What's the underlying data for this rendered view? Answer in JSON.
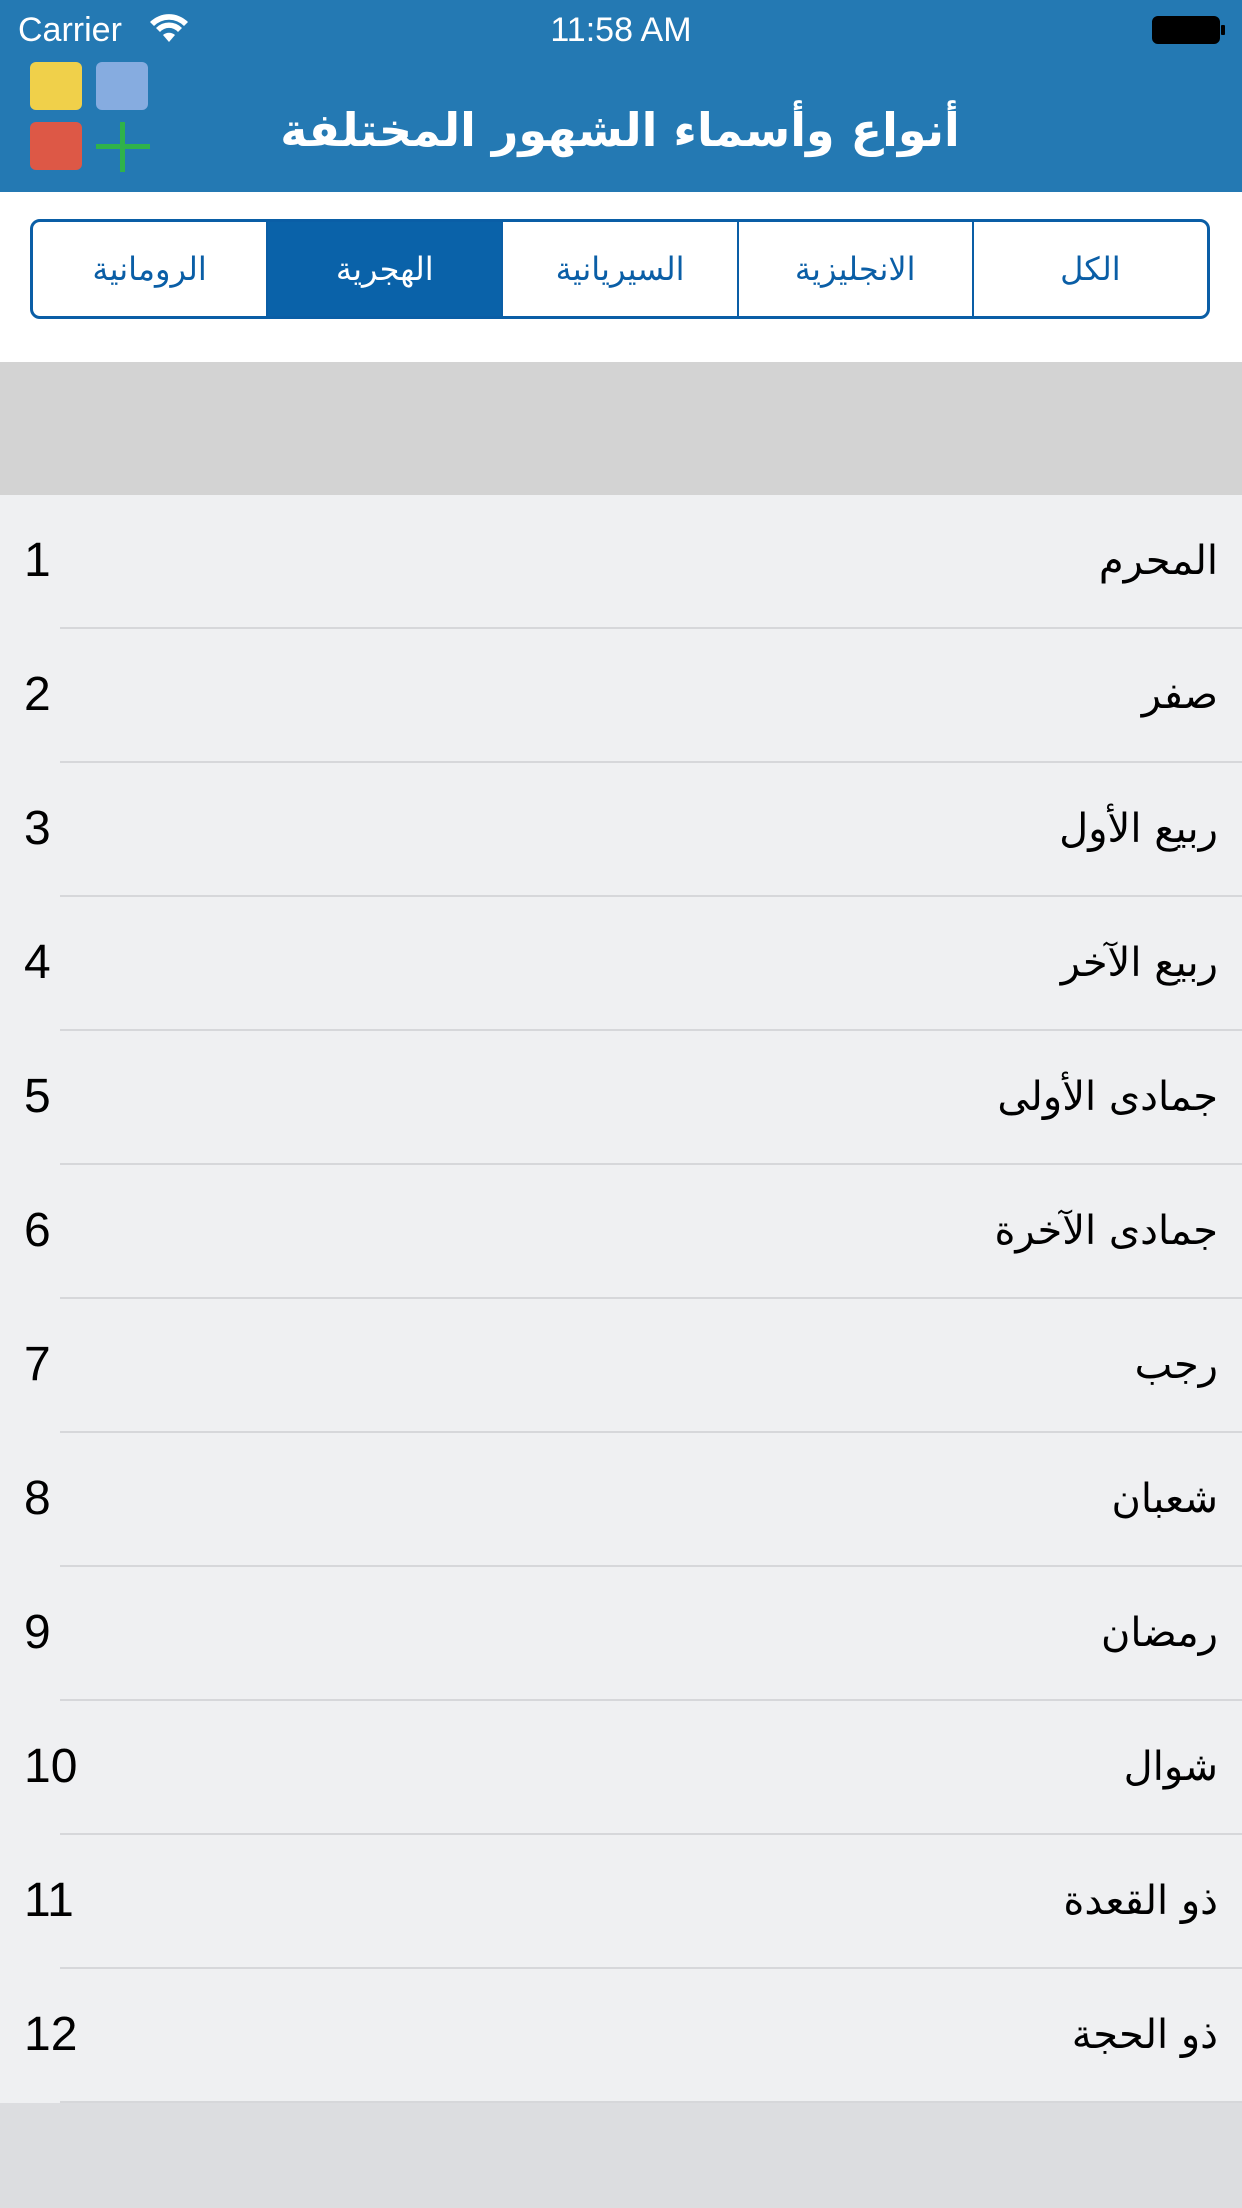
{
  "status_bar": {
    "carrier": "Carrier",
    "time": "11:58 AM"
  },
  "nav": {
    "title": "أنواع وأسماء الشهور المختلفة"
  },
  "segments": [
    {
      "label": "الرومانية",
      "selected": false
    },
    {
      "label": "الهجرية",
      "selected": true
    },
    {
      "label": "السيريانية",
      "selected": false
    },
    {
      "label": "الانجليزية",
      "selected": false
    },
    {
      "label": "الكل",
      "selected": false
    }
  ],
  "months": [
    {
      "number": "1",
      "name": "المحرم"
    },
    {
      "number": "2",
      "name": "صفر"
    },
    {
      "number": "3",
      "name": "ربيع الأول"
    },
    {
      "number": "4",
      "name": "ربيع الآخر"
    },
    {
      "number": "5",
      "name": "جمادى الأولى"
    },
    {
      "number": "6",
      "name": "جمادى الآخرة"
    },
    {
      "number": "7",
      "name": "رجب"
    },
    {
      "number": "8",
      "name": "شعبان"
    },
    {
      "number": "9",
      "name": "رمضان"
    },
    {
      "number": "10",
      "name": "شوال"
    },
    {
      "number": "11",
      "name": "ذو القعدة"
    },
    {
      "number": "12",
      "name": "ذو الحجة"
    }
  ],
  "colors": {
    "header": "#2479b3",
    "segment_accent": "#0a5ea6",
    "list_background": "#eff0f2",
    "section_header": "#d3d3d3"
  },
  "icons": {
    "wifi": "wifi-icon",
    "battery": "battery-icon",
    "logo": "app-logo"
  }
}
